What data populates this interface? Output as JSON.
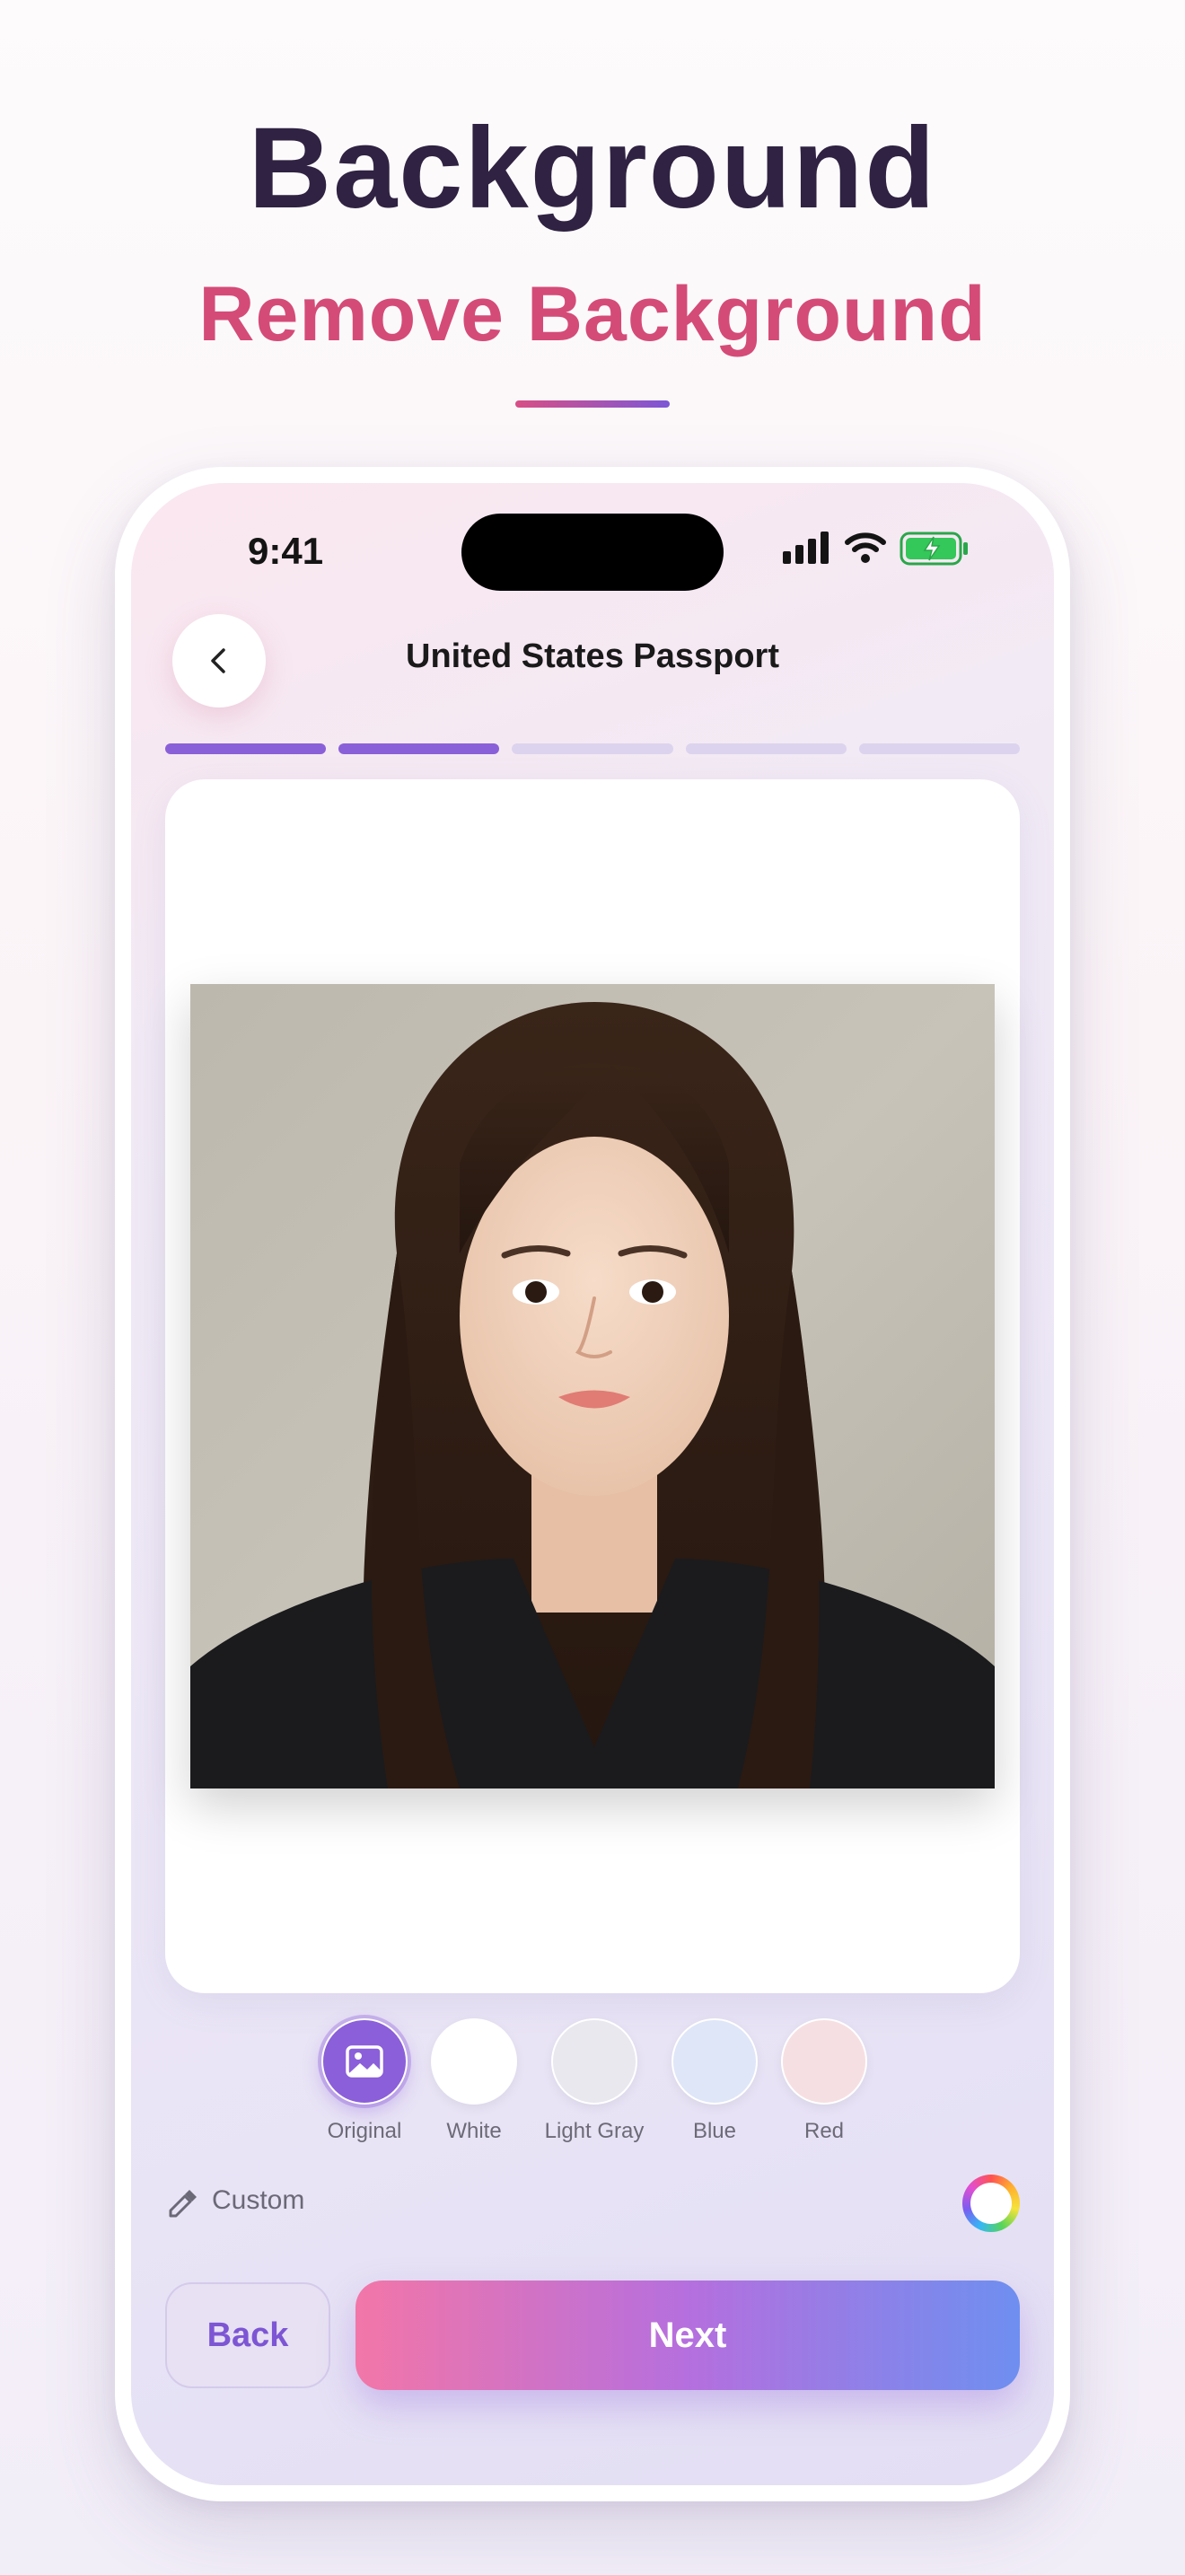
{
  "hero": {
    "title": "Background",
    "subtitle": "Remove Background"
  },
  "status_bar": {
    "time": "9:41"
  },
  "nav": {
    "title": "United States Passport",
    "back_icon": "chevron-left-icon"
  },
  "progress": {
    "total_steps": 5,
    "completed_steps": 2
  },
  "photo": {
    "alt": "portrait photo"
  },
  "background_options": [
    {
      "label": "Original",
      "color": "#8b5fd9",
      "selected": true,
      "icon": "image-icon"
    },
    {
      "label": "White",
      "color": "#ffffff",
      "selected": false
    },
    {
      "label": "Light Gray",
      "color": "#e8e8ee",
      "selected": false
    },
    {
      "label": "Blue",
      "color": "#dfe6f8",
      "selected": false
    },
    {
      "label": "Red",
      "color": "#f6dfe2",
      "selected": false
    }
  ],
  "custom": {
    "label": "Custom",
    "icon": "eyedropper-icon"
  },
  "actions": {
    "back_label": "Back",
    "next_label": "Next"
  },
  "colors": {
    "accent": "#8a60d8",
    "title": "#2f2242",
    "subtitle": "#d44b78"
  }
}
